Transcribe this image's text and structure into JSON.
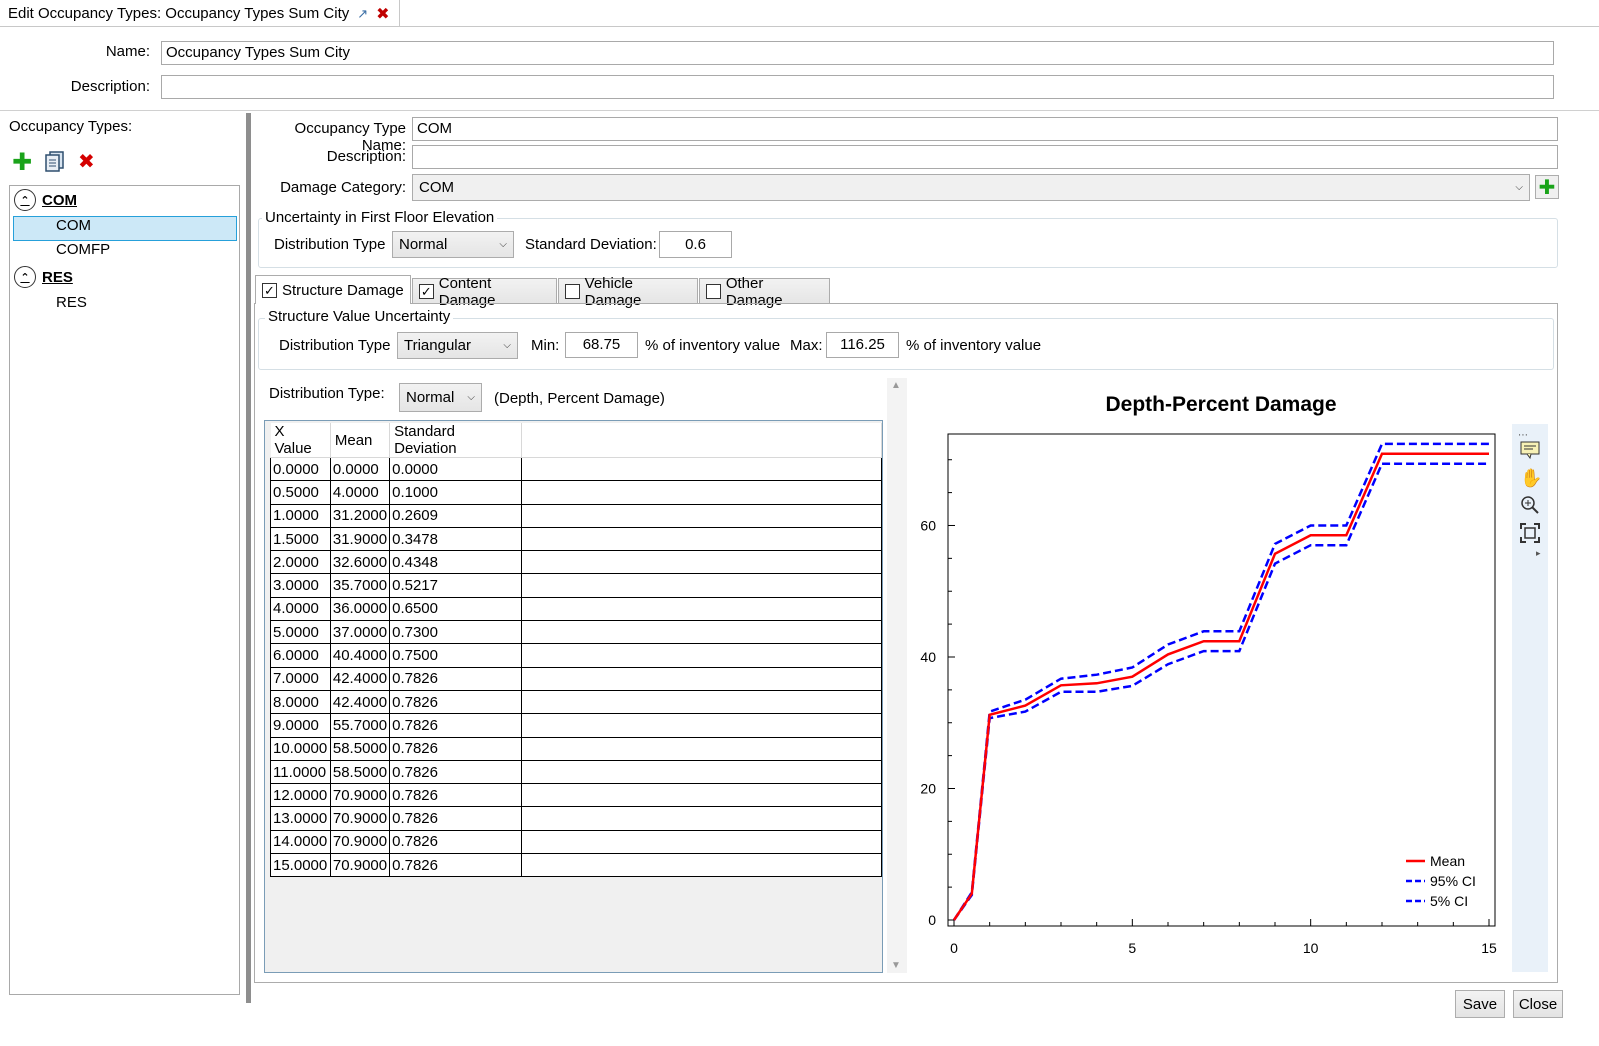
{
  "window": {
    "tab_title": "Edit Occupancy Types: Occupancy Types Sum City"
  },
  "header": {
    "name_label": "Name:",
    "name_value": "Occupancy Types Sum City",
    "description_label": "Description:",
    "description_value": ""
  },
  "left": {
    "title": "Occupancy Types:",
    "groups": [
      {
        "label": "COM",
        "items": [
          "COM",
          "COMFP"
        ]
      },
      {
        "label": "RES",
        "items": [
          "RES"
        ]
      }
    ],
    "selected_item": "COM"
  },
  "detail": {
    "occ_name_label": "Occupancy Type Name:",
    "occ_name_value": "COM",
    "description_label": "Description:",
    "description_value": "",
    "damage_category_label": "Damage Category:",
    "damage_category_value": "COM",
    "ffe_group_title": "Uncertainty in First Floor Elevation",
    "ffe_dist_label": "Distribution Type",
    "ffe_dist_value": "Normal",
    "ffe_std_label": "Standard Deviation:",
    "ffe_std_value": "0.6"
  },
  "tabs": [
    {
      "label": "Structure Damage",
      "checked": true,
      "active": true
    },
    {
      "label": "Content Damage",
      "checked": true,
      "active": false
    },
    {
      "label": "Vehicle Damage",
      "checked": false,
      "active": false
    },
    {
      "label": "Other Damage",
      "checked": false,
      "active": false
    }
  ],
  "structure": {
    "group_title": "Structure Value Uncertainty",
    "dist_label": "Distribution Type",
    "dist_value": "Triangular",
    "min_label": "Min:",
    "min_value": "68.75",
    "min_unit": "% of inventory value",
    "max_label": "Max:",
    "max_value": "116.25",
    "max_unit": "% of inventory value",
    "curve_dist_label": "Distribution Type:",
    "curve_dist_value": "Normal",
    "curve_dist_note": "(Depth, Percent Damage)"
  },
  "table": {
    "columns": [
      "X Value",
      "Mean",
      "Standard Deviation"
    ],
    "rows": [
      [
        "0.0000",
        "0.0000",
        "0.0000"
      ],
      [
        "0.5000",
        "4.0000",
        "0.1000"
      ],
      [
        "1.0000",
        "31.2000",
        "0.2609"
      ],
      [
        "1.5000",
        "31.9000",
        "0.3478"
      ],
      [
        "2.0000",
        "32.6000",
        "0.4348"
      ],
      [
        "3.0000",
        "35.7000",
        "0.5217"
      ],
      [
        "4.0000",
        "36.0000",
        "0.6500"
      ],
      [
        "5.0000",
        "37.0000",
        "0.7300"
      ],
      [
        "6.0000",
        "40.4000",
        "0.7500"
      ],
      [
        "7.0000",
        "42.4000",
        "0.7826"
      ],
      [
        "8.0000",
        "42.4000",
        "0.7826"
      ],
      [
        "9.0000",
        "55.7000",
        "0.7826"
      ],
      [
        "10.0000",
        "58.5000",
        "0.7826"
      ],
      [
        "11.0000",
        "58.5000",
        "0.7826"
      ],
      [
        "12.0000",
        "70.9000",
        "0.7826"
      ],
      [
        "13.0000",
        "70.9000",
        "0.7826"
      ],
      [
        "14.0000",
        "70.9000",
        "0.7826"
      ],
      [
        "15.0000",
        "70.9000",
        "0.7826"
      ]
    ]
  },
  "chart_data": {
    "type": "line",
    "title": "Depth-Percent Damage",
    "xlabel": "",
    "ylabel": "",
    "xlim": [
      0,
      15
    ],
    "ylim": [
      0,
      73
    ],
    "x_ticks": [
      0,
      5,
      10,
      15
    ],
    "y_ticks": [
      0,
      20,
      40,
      60
    ],
    "x": [
      0,
      0.5,
      1,
      1.5,
      2,
      3,
      4,
      5,
      6,
      7,
      8,
      9,
      10,
      11,
      12,
      13,
      14,
      15
    ],
    "series": [
      {
        "name": "Mean",
        "color": "#ff0000",
        "dash": false,
        "values": [
          0,
          4,
          31.2,
          31.9,
          32.6,
          35.7,
          36,
          37,
          40.4,
          42.4,
          42.4,
          55.7,
          58.5,
          58.5,
          70.9,
          70.9,
          70.9,
          70.9
        ]
      },
      {
        "name": "95% CI",
        "color": "#0000ff",
        "dash": true,
        "values": [
          0,
          4.2,
          31.7,
          32.6,
          33.5,
          36.7,
          37.3,
          38.4,
          41.9,
          43.9,
          43.9,
          57.2,
          60,
          60,
          72.4,
          72.4,
          72.4,
          72.4
        ]
      },
      {
        "name": "5% CI",
        "color": "#0000ff",
        "dash": true,
        "values": [
          0,
          3.8,
          30.7,
          31.2,
          31.7,
          34.7,
          34.7,
          35.6,
          38.9,
          40.9,
          40.9,
          54.2,
          57,
          57,
          69.4,
          69.4,
          69.4,
          69.4
        ]
      }
    ],
    "legend_position": "bottom-right",
    "grid": false
  },
  "footer": {
    "save_label": "Save",
    "close_label": "Close"
  }
}
